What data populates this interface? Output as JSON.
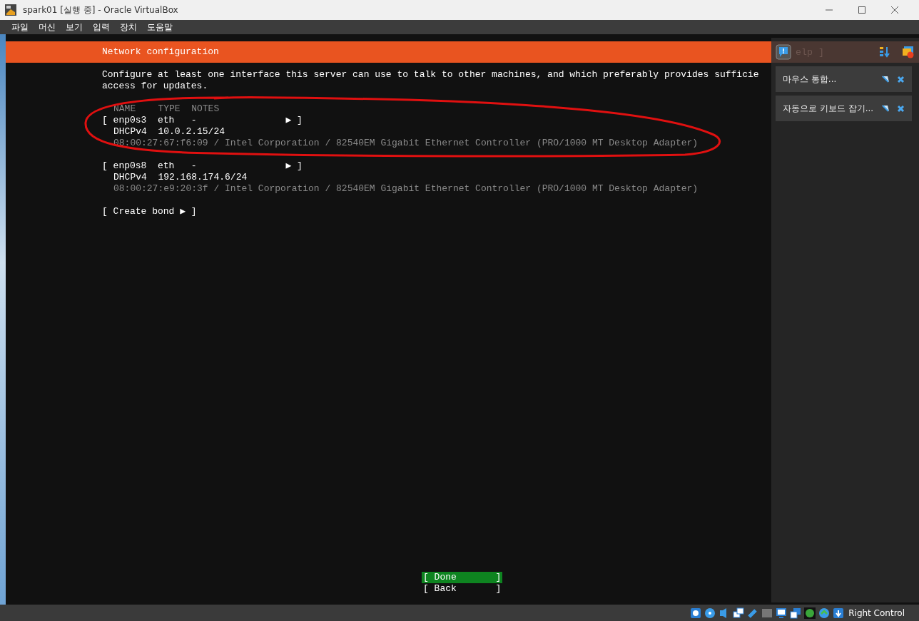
{
  "window": {
    "title": "spark01 [실행 중] - Oracle VirtualBox"
  },
  "menu": [
    "파일",
    "머신",
    "보기",
    "입력",
    "장치",
    "도움말"
  ],
  "screen": {
    "header_title": "Network configuration",
    "help_hint": "elp ]",
    "description": [
      "Configure at least one interface this server can use to talk to other machines, and which preferably provides sufficie",
      "access for updates."
    ],
    "columns_header": "NAME    TYPE  NOTES",
    "interfaces": [
      {
        "row_label": "[ enp0s3  eth   -                ▶ ]",
        "address_line": "DHCPv4  10.0.2.15/24",
        "hardware": "08:00:27:67:f6:09 / Intel Corporation / 82540EM Gigabit Ethernet Controller (PRO/1000 MT Desktop Adapter)"
      },
      {
        "row_label": "[ enp0s8  eth   -                ▶ ]",
        "address_line": "DHCPv4  192.168.174.6/24",
        "hardware": "08:00:27:e9:20:3f / Intel Corporation / 82540EM Gigabit Ethernet Controller (PRO/1000 MT Desktop Adapter)"
      }
    ],
    "create_bond": "[ Create bond ▶ ]",
    "buttons": [
      {
        "label": "[ Done       ]",
        "selected": true
      },
      {
        "label": "[ Back       ]",
        "selected": false
      }
    ]
  },
  "notifications": [
    {
      "text": "마우스 통합..."
    },
    {
      "text": "자동으로 키보드 잡기..."
    }
  ],
  "status_bar": {
    "host_key": "Right Control"
  }
}
